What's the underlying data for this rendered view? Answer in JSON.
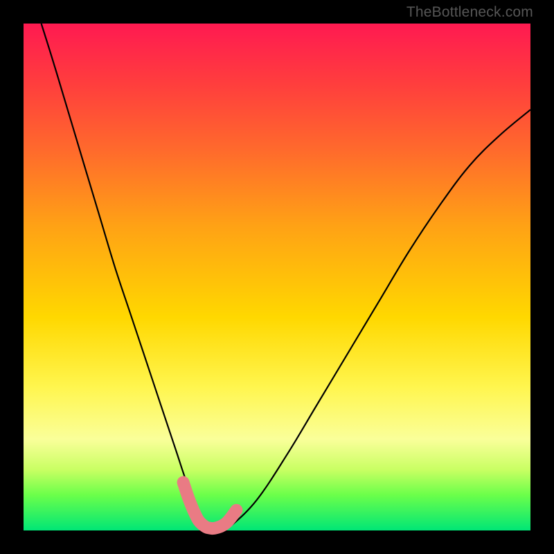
{
  "watermark": {
    "text": "TheBottleneck.com"
  },
  "chart_data": {
    "type": "line",
    "title": "",
    "xlabel": "",
    "ylabel": "",
    "xlim": [
      0,
      1
    ],
    "ylim": [
      0,
      1
    ],
    "background_gradient": {
      "top": "#ff1a51",
      "mid": "#ffd800",
      "bottom": "#00e676"
    },
    "series": [
      {
        "name": "bottleneck-curve",
        "stroke": "#000000",
        "x": [
          0.035,
          0.06,
          0.09,
          0.12,
          0.15,
          0.18,
          0.21,
          0.24,
          0.27,
          0.3,
          0.32,
          0.34,
          0.355,
          0.37,
          0.39,
          0.41,
          0.46,
          0.52,
          0.58,
          0.64,
          0.7,
          0.76,
          0.82,
          0.88,
          0.94,
          1.0
        ],
        "y": [
          1.0,
          0.92,
          0.82,
          0.72,
          0.62,
          0.52,
          0.43,
          0.34,
          0.25,
          0.16,
          0.1,
          0.05,
          0.015,
          0.0,
          0.0,
          0.01,
          0.06,
          0.15,
          0.25,
          0.35,
          0.45,
          0.55,
          0.64,
          0.72,
          0.78,
          0.83
        ]
      },
      {
        "name": "highlight-segment",
        "stroke": "#e97b84",
        "x": [
          0.315,
          0.325,
          0.335,
          0.345,
          0.355,
          0.365,
          0.38,
          0.4,
          0.42
        ],
        "y": [
          0.095,
          0.065,
          0.04,
          0.02,
          0.01,
          0.005,
          0.005,
          0.015,
          0.04
        ]
      }
    ]
  }
}
